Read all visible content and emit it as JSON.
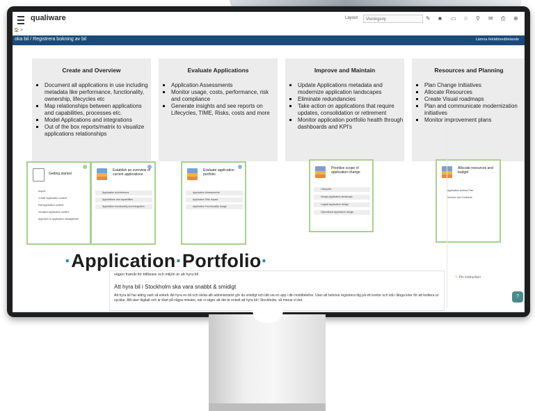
{
  "app": {
    "logo": "qualiware"
  },
  "toolbar": {
    "layout_label": "Layout",
    "layout_value": "Visningsny",
    "icons": [
      "tag-icon",
      "camera-icon",
      "monitor-icon",
      "star-icon",
      "search-icon",
      "mail-icon",
      "print-icon",
      "help-icon"
    ]
  },
  "breadcrumb": {
    "home": "🏠 >",
    "path": "oka bil / Registrera bokning av bil",
    "right_action": "Lämna felrättmeddelande"
  },
  "categories": [
    {
      "title": "Create and Overview",
      "items": [
        "Document all applications in use including metadata like performance, functionality, ownership, lifecycles etc",
        "Map relationships between applications and capabilities, processes etc.",
        "Model Applications and integrations",
        "Out of the box reports/matrix to visualize applications relationships"
      ]
    },
    {
      "title": "Evaluate Applications",
      "items": [
        "Application Assessments",
        "Monitor usage, costs, performance, risk and compliance",
        "Generate insights and see reports on Lifecycles, TIME, Risks, costs and more"
      ]
    },
    {
      "title": "Improve and Maintain",
      "items": [
        "Update Applications metadata and modernize application landscapes",
        "Eliminate redundancies",
        "Take action on applications that require updates, consolidation or retirement",
        "Monitor application portfolio health through dashboards and KPI's"
      ]
    },
    {
      "title": "Resources and Planning",
      "items": [
        "Plan Change Initiatives",
        "Allocate Resources",
        "Create Visual roadmaps",
        "Plan and communicate modernization initiatives",
        "Monitor improvement plans"
      ]
    }
  ],
  "cards": [
    {
      "title": "Getting started",
      "rows": [
        "Import",
        "Create Application content",
        "Edit Application content",
        "Visualize Application content",
        "Approach to Application management"
      ]
    },
    {
      "title": "Establish an overview of current applications",
      "rows": [
        "Application Architectures",
        "Applications and capabilities",
        "Application functionality and integration"
      ]
    },
    {
      "title": "Evaluate application portfolio",
      "rows": [
        "Application Assessments",
        "Application Risk Impact",
        "Application Functionality Usage"
      ]
    },
    {
      "title": "Prioritize scope of application change",
      "rows": [
        "Lifecycles",
        "Design Application landscape",
        "Logical Application design",
        "Operational Application design"
      ]
    },
    {
      "title": "Allocate resources and budget",
      "rows": [
        "Application Actions Plan",
        "Vendors and Contracts"
      ]
    }
  ],
  "banner": {
    "word1": "Application",
    "word2": "Portfolio"
  },
  "document": {
    "top_line": "vägen framåt för bilfarare och miljön är att hyra bil",
    "heading": "Att hyra bil i Stockholm ska vara snabbt & smidigt",
    "paragraph": "Att hyra bil har aldrig varit så enkelt. Att hyra en bil och sköta allt administrativt gör du smidigt och lätt via en app i din mobiltelefon. Utan att behöva registrera dig på ett kontor och stå i långa köer för att kvittera ut nycklar. Allt sker digitalt och är klart på några minuter, när vi säger att det är enkelt att hyra bil i Stockholm, så menar vi det."
  },
  "side": {
    "pin_label": "Pin instruction"
  },
  "help_label": "?"
}
